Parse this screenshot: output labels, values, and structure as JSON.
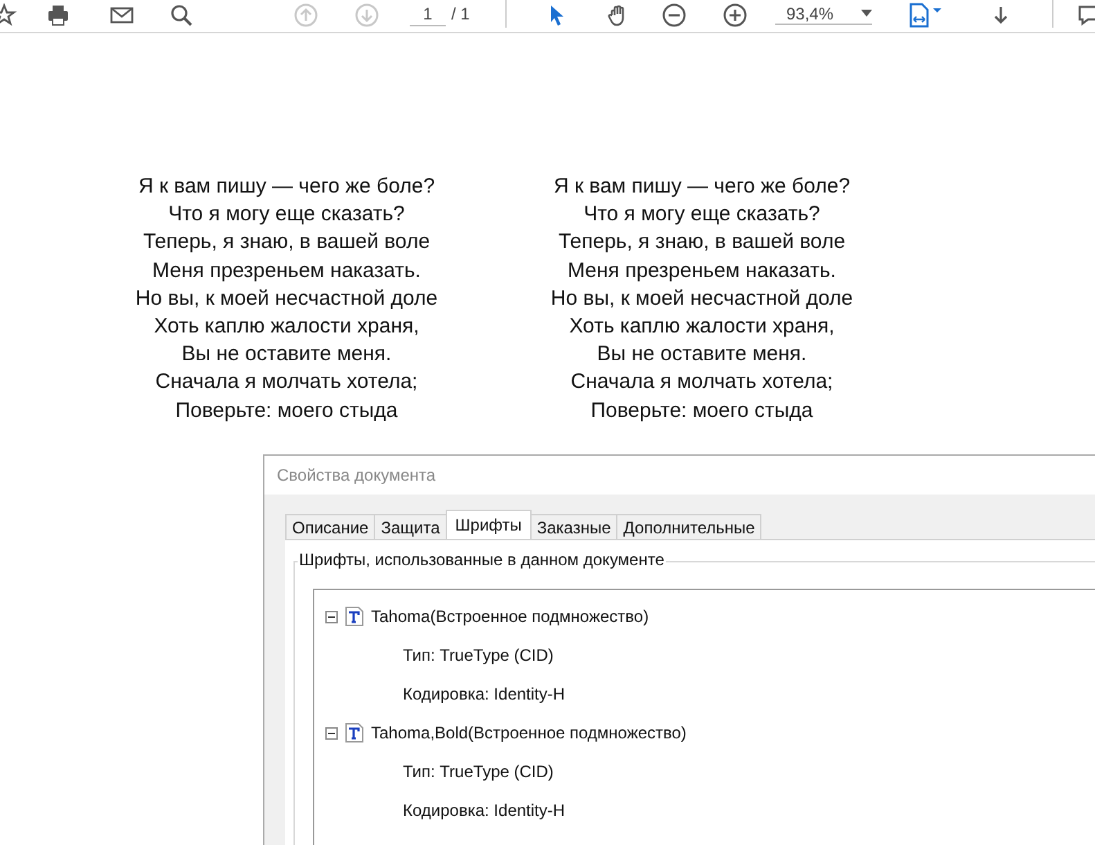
{
  "toolbar": {
    "page_nav": [
      {
        "kind": "up",
        "disabled": true
      },
      {
        "kind": "down",
        "disabled": true
      }
    ],
    "page_number": "1",
    "page_total": "/ 1",
    "tools": [
      {
        "kind": "select",
        "selected": true
      },
      {
        "kind": "hand",
        "selected": false
      }
    ],
    "zoom": "93,4%"
  },
  "document": {
    "columns": [
      {
        "lines": [
          "Я к вам пишу — чего же боле?",
          "Что я могу еще сказать?",
          "Теперь, я знаю, в вашей воле",
          "Меня презреньем наказать.",
          "Но вы, к моей несчастной доле",
          "Хоть каплю жалости храня,",
          "Вы не оставите меня.",
          "Сначала я молчать хотела;",
          "Поверьте: моего стыда"
        ]
      },
      {
        "lines": [
          "Я к вам пишу — чего же боле?",
          "Что я могу еще сказать?",
          "Теперь, я знаю, в вашей воле",
          "Меня презреньем наказать.",
          "Но вы, к моей несчастной доле",
          "Хоть каплю жалости храня,",
          "Вы не оставите меня.",
          "Сначала я молчать хотела;",
          "Поверьте: моего стыда"
        ]
      }
    ]
  },
  "dialog": {
    "title": "Свойства документа",
    "tabs": [
      {
        "label": "Описание",
        "selected": false
      },
      {
        "label": "Защита",
        "selected": false
      },
      {
        "label": "Шрифты",
        "selected": true
      },
      {
        "label": "Заказные",
        "selected": false
      },
      {
        "label": "Дополнительные",
        "selected": false
      }
    ],
    "group_label": "Шрифты, использованные в данном документе",
    "fonts": [
      {
        "label": "Tahoma(Встроенное подмножество)",
        "expanded": true,
        "children": [
          {
            "label": "Тип: TrueType (CID)"
          },
          {
            "label": "Кодировка: Identity-H"
          }
        ]
      },
      {
        "label": "Tahoma,Bold(Встроенное подмножество)",
        "expanded": true,
        "children": [
          {
            "label": "Тип: TrueType (CID)"
          },
          {
            "label": "Кодировка: Identity-H"
          }
        ]
      }
    ]
  }
}
